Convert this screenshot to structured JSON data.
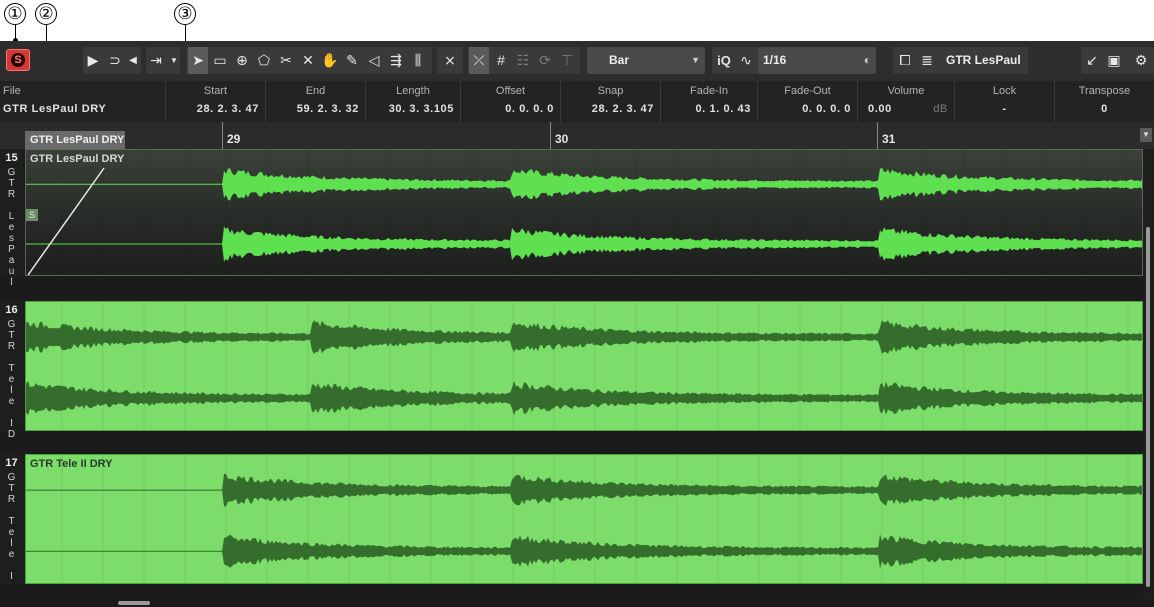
{
  "callouts": [
    "①",
    "②",
    "③"
  ],
  "toolbar": {
    "solo_label": "S",
    "snap_type": "Bar",
    "iq_label": "iQ",
    "quantize_value": "1/16",
    "track_select": "GTR LesPaul D",
    "colors": {
      "solo": "#d23a3a",
      "background": "#2d2d2d"
    }
  },
  "infoline": {
    "file": {
      "label": "File",
      "value": "GTR LesPaul DRY"
    },
    "columns": [
      {
        "label": "Start",
        "value": "28. 2. 3. 47"
      },
      {
        "label": "End",
        "value": "59. 2. 3. 32"
      },
      {
        "label": "Length",
        "value": "30. 3. 3.105"
      },
      {
        "label": "Offset",
        "value": "0. 0. 0. 0"
      },
      {
        "label": "Snap",
        "value": "28. 2. 3. 47"
      },
      {
        "label": "Fade-In",
        "value": "0. 1. 0. 43"
      },
      {
        "label": "Fade-Out",
        "value": "0. 0. 0. 0"
      },
      {
        "label": "Volume",
        "value": "0.00",
        "unit": "dB"
      },
      {
        "label": "Lock",
        "value": "-"
      },
      {
        "label": "Transpose",
        "value": "0"
      }
    ]
  },
  "ruler": {
    "part": "GTR LesPaul DRY",
    "bars": [
      "29",
      "30",
      "31"
    ]
  },
  "tracks": [
    {
      "number": "15",
      "vertical_name": [
        "G",
        "T",
        "R",
        "",
        "L",
        "e",
        "s",
        "P",
        "a",
        "u",
        "l"
      ],
      "event": "GTR LesPaul DRY",
      "selected": true,
      "solo_badge": "S"
    },
    {
      "number": "16",
      "vertical_name": [
        "G",
        "T",
        "R",
        "",
        "T",
        "e",
        "l",
        "e",
        "",
        "I",
        "D"
      ],
      "event": "",
      "selected": false
    },
    {
      "number": "17",
      "vertical_name": [
        "G",
        "T",
        "R",
        "",
        "T",
        "e",
        "l",
        "e",
        "",
        "I"
      ],
      "event": "GTR Tele II DRY",
      "selected": false
    }
  ],
  "colors": {
    "waveform_bright": "#5fe050",
    "waveform_dark": "#2f6a28",
    "event_light": "#7ddd6a"
  }
}
